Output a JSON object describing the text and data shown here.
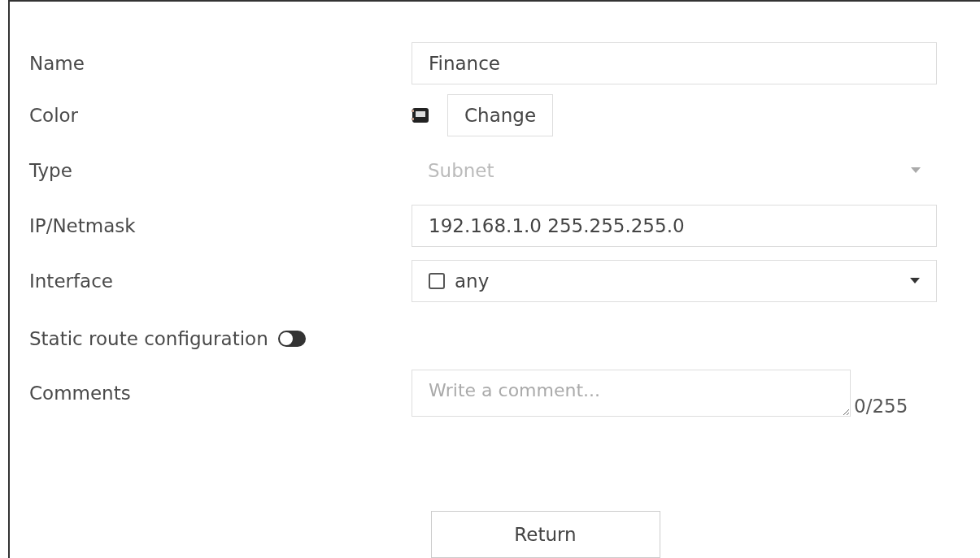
{
  "fields": [
    {
      "kind": "text",
      "label": "Name",
      "value": "Finance"
    },
    {
      "kind": "color",
      "label": "Color",
      "button": "Change"
    },
    {
      "kind": "select",
      "label": "Type",
      "value": "Subnet",
      "disabled": true
    },
    {
      "kind": "text",
      "label": "IP/Netmask",
      "value": "192.168.1.0 255.255.255.0"
    },
    {
      "kind": "multiselect",
      "label": "Interface",
      "value": "any",
      "checked": false
    },
    {
      "kind": "toggle",
      "label": "Static route configuration",
      "on": false
    },
    {
      "kind": "textarea",
      "label": "Comments",
      "placeholder": "Write a comment...",
      "counter": "0/255"
    }
  ],
  "buttons": [
    "Return"
  ]
}
